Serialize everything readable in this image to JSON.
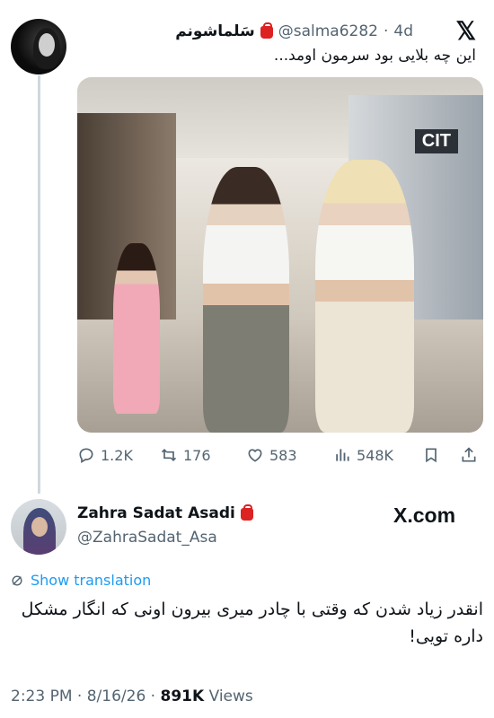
{
  "quoted": {
    "display_name": "سَلماشونم",
    "handle": "@salma6282",
    "separator": "·",
    "age": "4d",
    "text": "این چه بلایی بود سرمون اومد...",
    "media_sign": "CIT",
    "stats": {
      "replies": "1.2K",
      "reposts": "176",
      "likes": "583",
      "views": "548K"
    }
  },
  "tweet": {
    "display_name": "Zahra Sadat Asadi",
    "handle": "@ZahraSadat_Asa",
    "brand": "X.com",
    "translate_label": "Show translation",
    "text": "انقدر زیاد شدن که وقتی با چادر میری بیرون اونی که انگار مشکل داره تویی!",
    "time": "2:23 PM",
    "date": "8/16/26",
    "views": "891K",
    "views_label": "Views",
    "meta_sep": "·"
  },
  "colors": {
    "text": "#0f1419",
    "muted": "#536471",
    "link": "#1d9bf0",
    "badge": "#dd2222",
    "thread_line": "#cfd9de"
  },
  "icons": [
    "reply-icon",
    "repost-icon",
    "like-icon",
    "views-icon",
    "bookmark-icon",
    "share-icon",
    "translate-icon",
    "x-logo-icon",
    "bag-emoji-icon"
  ]
}
